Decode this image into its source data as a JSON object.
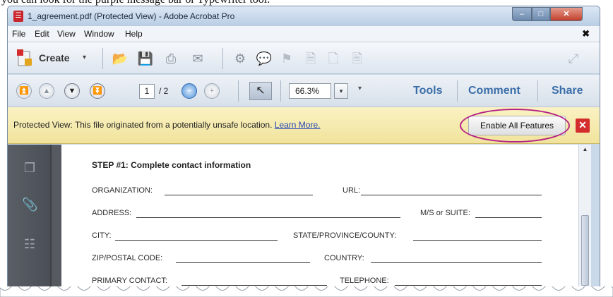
{
  "caption": "you can look for the purple message bar or Typewriter tool.",
  "window": {
    "title": "1_agreement.pdf (Protected View) - Adobe Acrobat Pro",
    "controls": {
      "minimize": "–",
      "maximize": "□",
      "close": "✕"
    }
  },
  "menu": {
    "items": [
      "File",
      "Edit",
      "View",
      "Window",
      "Help"
    ],
    "close": "✖"
  },
  "toolbar": {
    "create_label": "Create",
    "create_caret": "▾",
    "icons": [
      "open-folder",
      "save",
      "print",
      "email",
      "settings",
      "comment",
      "attach",
      "document",
      "export",
      "page"
    ]
  },
  "navbar": {
    "page_current": "1",
    "page_total": "/ 2",
    "zoom": "66.3%",
    "zoom_caret": "▾",
    "zoom_more": "▾",
    "tabs": [
      "Tools",
      "Comment",
      "Share"
    ]
  },
  "protected_bar": {
    "message": "Protected View: This file originated from a potentially unsafe location.",
    "link": "Learn More.",
    "button": "Enable All Features",
    "close": "✕",
    "highlight_color": "#b42085"
  },
  "document": {
    "step_title": "STEP #1: Complete contact information",
    "fields": [
      {
        "label": "ORGANIZATION:"
      },
      {
        "label": "URL:"
      },
      {
        "label": "ADDRESS:"
      },
      {
        "label": "M/S or SUITE:"
      },
      {
        "label": "CITY:"
      },
      {
        "label": "STATE/PROVINCE/COUNTY:"
      },
      {
        "label": "ZIP/POSTAL CODE:"
      },
      {
        "label": "COUNTRY:"
      },
      {
        "label": "PRIMARY CONTACT:"
      },
      {
        "label": "TELEPHONE:"
      }
    ]
  }
}
